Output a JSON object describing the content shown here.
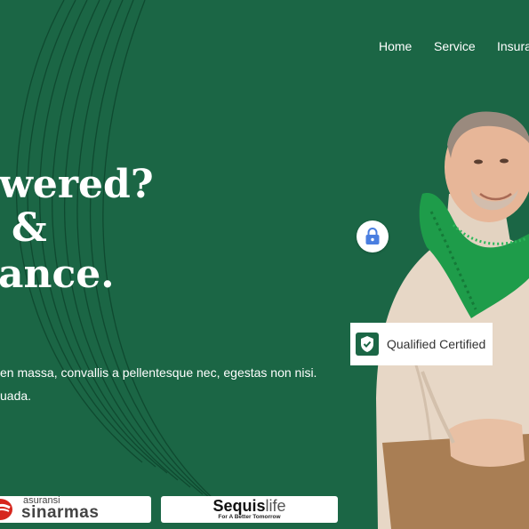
{
  "nav": {
    "items": [
      {
        "label": "Home"
      },
      {
        "label": "Service"
      },
      {
        "label": "Insura"
      }
    ]
  },
  "hero": {
    "headline_lines": [
      "wered?",
      "&",
      "ance."
    ],
    "paragraph_lines": [
      "en massa, convallis a pellentesque nec, egestas non nisi.",
      "uada."
    ]
  },
  "badges": {
    "lock_icon": "lock-icon",
    "certified_label": "Qualified Certified",
    "certified_icon": "shield-check-icon"
  },
  "partners": {
    "sinarmas": {
      "small": "asuransi",
      "big": "sinarmas"
    },
    "sequis": {
      "name_main": "Sequis",
      "name_suffix": "life",
      "tagline": "For A Better Tomorrow"
    }
  },
  "colors": {
    "background": "#1b6645",
    "accent_green": "#1e9c4a",
    "badge_icon_blue": "#4a7ee0",
    "sinarmas_red": "#d6261d"
  }
}
